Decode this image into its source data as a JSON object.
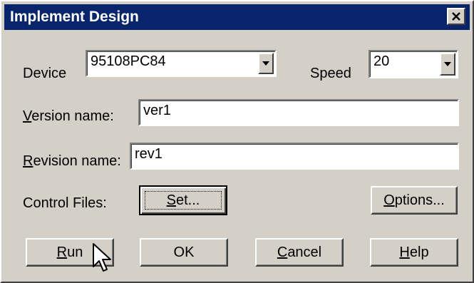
{
  "window": {
    "title": "Implement Design"
  },
  "device": {
    "label": "Device",
    "value": "95108PC84"
  },
  "speed": {
    "label": "Speed",
    "value": "20"
  },
  "version": {
    "label_underlined": "V",
    "label_rest": "ersion name:",
    "value": "ver1"
  },
  "revision": {
    "label_underlined": "R",
    "label_rest": "evision name:",
    "value": "rev1"
  },
  "control_files": {
    "label": "Control Files:",
    "set_underlined": "S",
    "set_rest": "et...",
    "options_underlined": "O",
    "options_rest": "ptions..."
  },
  "buttons": {
    "run_underlined": "R",
    "run_rest": "un",
    "ok": "OK",
    "cancel_underlined": "C",
    "cancel_rest": "ancel",
    "help_underlined": "H",
    "help_rest": "elp"
  },
  "colors": {
    "titlebar": "#08246b",
    "face": "#d4d0c8"
  },
  "icons": {
    "close": "close-icon",
    "dropdown": "chevron-down-icon",
    "cursor": "mouse-pointer-icon"
  }
}
